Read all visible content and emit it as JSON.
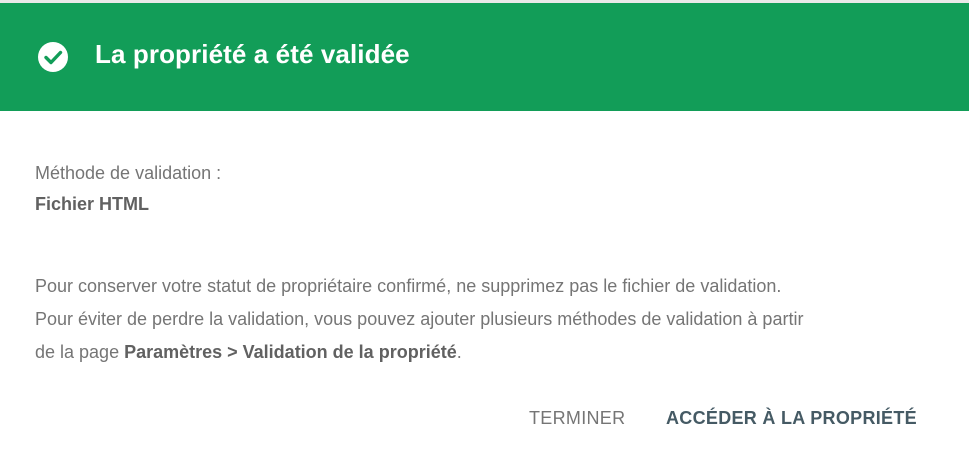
{
  "dialog": {
    "header": {
      "title": "La propriété a été validée",
      "icon": "check-circle-icon",
      "background_color": "#129d58"
    },
    "method": {
      "label": "Méthode de validation :",
      "value": "Fichier HTML"
    },
    "info": {
      "line1": "Pour conserver votre statut de propriétaire confirmé, ne supprimez pas le fichier de validation.",
      "line2": "Pour éviter de perdre la validation, vous pouvez ajouter plusieurs méthodes de validation à partir",
      "line3_prefix": "de la page ",
      "line3_bold": "Paramètres > Validation de la propriété",
      "line3_suffix": "."
    },
    "actions": {
      "finish_label": "TERMINER",
      "goto_label": "ACCÉDER À LA PROPRIÉTÉ"
    }
  }
}
